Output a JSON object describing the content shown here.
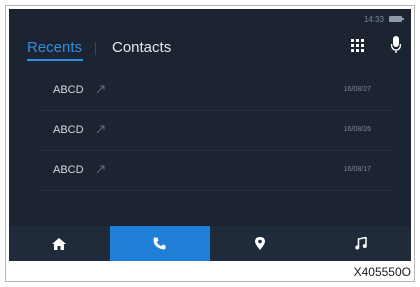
{
  "status": {
    "time": "14:33",
    "battery_icon": "battery-icon"
  },
  "tabs": [
    {
      "label": "Recents",
      "active": true
    },
    {
      "label": "Contacts",
      "active": false
    }
  ],
  "header_icons": [
    "dialpad-icon",
    "microphone-icon"
  ],
  "calls": [
    {
      "name": "ABCD",
      "direction_icon": "outgoing-call-arrow-icon",
      "date": "16/08/27"
    },
    {
      "name": "ABCD",
      "direction_icon": "outgoing-call-arrow-icon",
      "date": "16/08/26"
    },
    {
      "name": "ABCD",
      "direction_icon": "outgoing-call-arrow-icon",
      "date": "16/08/17"
    }
  ],
  "bottom_nav": [
    {
      "icon": "home-icon",
      "active": false
    },
    {
      "icon": "phone-icon",
      "active": true
    },
    {
      "icon": "map-pin-icon",
      "active": false
    },
    {
      "icon": "music-note-icon",
      "active": false
    }
  ],
  "colors": {
    "accent": "#1f7fd6",
    "screen_bg": "#1c2432",
    "text": "#d5dae2"
  },
  "caption": "X405550O"
}
